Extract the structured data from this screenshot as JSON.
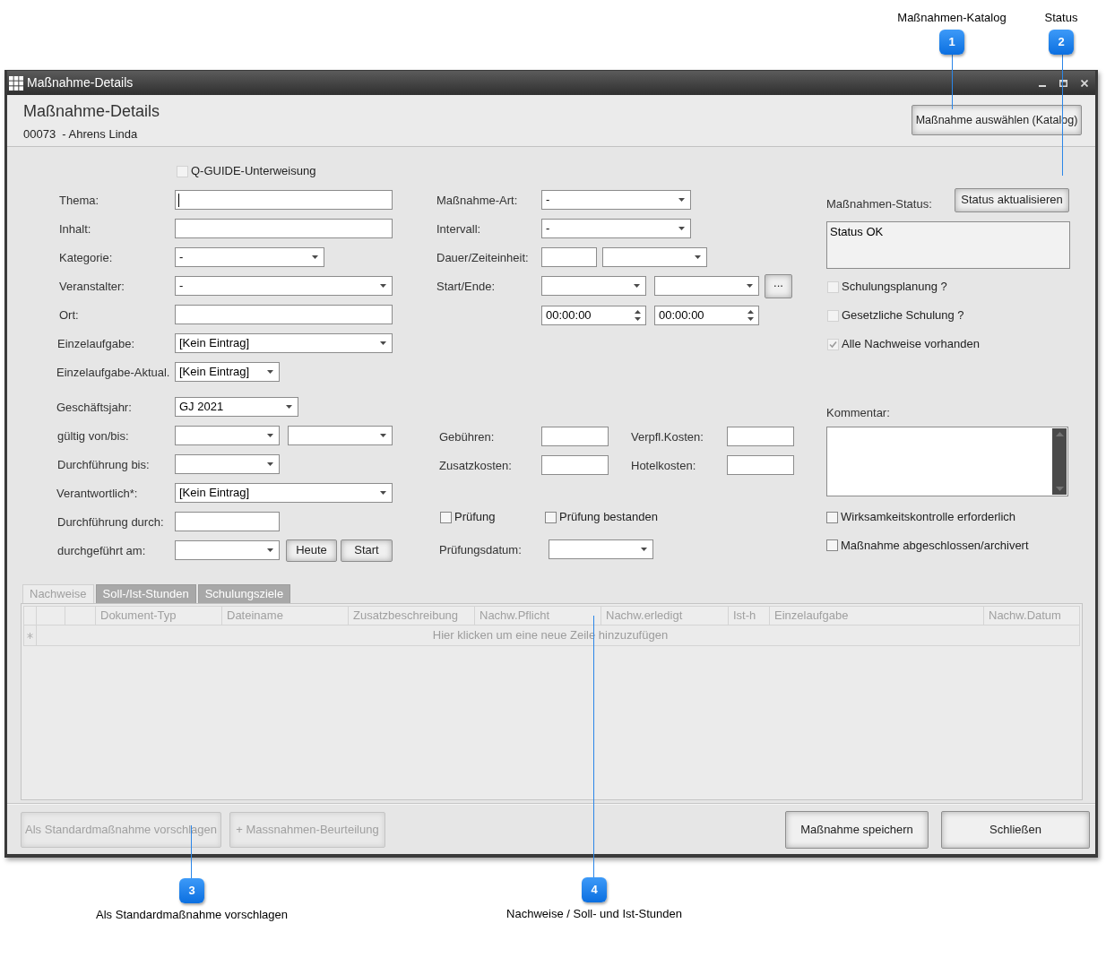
{
  "callouts": [
    {
      "number": "1",
      "label": "Maßnahmen-Katalog"
    },
    {
      "number": "2",
      "label": "Status"
    },
    {
      "number": "3",
      "label": "Als Standardmaßnahme vorschlagen"
    },
    {
      "number": "4",
      "label": "Nachweise / Soll- und Ist-Stunden"
    }
  ],
  "window": {
    "title": "Maßnahme-Details"
  },
  "header": {
    "title": "Maßnahme-Details",
    "record": "00073  - Ahrens Linda",
    "catalog_button": "Maßnahme auswählen (Katalog)"
  },
  "left_form": {
    "q_guide": {
      "label": "Q-GUIDE-Unterweisung",
      "checked": false,
      "disabled": true
    },
    "rows": [
      {
        "label": "Thema:",
        "controls": [
          {
            "kind": "text",
            "focused": true
          }
        ]
      },
      {
        "label": "Inhalt:",
        "controls": [
          {
            "kind": "text",
            "focused": false
          }
        ]
      },
      {
        "label": "Kategorie:",
        "controls": [
          {
            "kind": "dropdown",
            "value": "-"
          }
        ]
      },
      {
        "label": "Veranstalter:",
        "controls": [
          {
            "kind": "dropdown",
            "value": "-"
          }
        ]
      },
      {
        "label": "Ort:",
        "controls": [
          {
            "kind": "text",
            "focused": false
          }
        ]
      },
      {
        "label": "Einzelaufgabe:",
        "controls": [
          {
            "kind": "dropdown",
            "value": "[Kein Eintrag]"
          }
        ]
      },
      {
        "label": "Einzelaufgabe-Aktual.",
        "controls": [
          {
            "kind": "dropdown",
            "value": "[Kein Eintrag]"
          }
        ]
      },
      {
        "label": "Geschäftsjahr:",
        "controls": [
          {
            "kind": "dropdown",
            "value": "GJ 2021"
          }
        ]
      },
      {
        "label": "gültig von/bis:",
        "controls": [
          {
            "kind": "dropdown"
          },
          {
            "kind": "dropdown"
          }
        ]
      },
      {
        "label": "Durchführung bis:",
        "controls": [
          {
            "kind": "dropdown"
          }
        ]
      },
      {
        "label": "Verantwortlich*:",
        "controls": [
          {
            "kind": "dropdown",
            "value": "[Kein Eintrag]"
          }
        ]
      },
      {
        "label": "Durchführung durch:",
        "controls": [
          {
            "kind": "text",
            "focused": false
          }
        ]
      },
      {
        "label": "durchgeführt am:",
        "controls": [
          {
            "kind": "dropdown"
          },
          {
            "kind": "button",
            "label": "Heute"
          },
          {
            "kind": "button",
            "label": "Start"
          }
        ]
      }
    ]
  },
  "middle_form": {
    "rows": [
      {
        "label": "Maßnahme-Art:",
        "controls": [
          {
            "kind": "dropdown",
            "value": "-"
          }
        ]
      },
      {
        "label": "Intervall:",
        "controls": [
          {
            "kind": "dropdown",
            "value": "-"
          }
        ]
      },
      {
        "label": "Dauer/Zeiteinheit:",
        "controls": [
          {
            "kind": "text",
            "focused": false
          },
          {
            "kind": "dropdown"
          }
        ]
      },
      {
        "label": "Start/Ende:",
        "controls": [
          {
            "kind": "dropdown"
          },
          {
            "kind": "dropdown"
          },
          {
            "kind": "button",
            "label": "..."
          }
        ]
      },
      {
        "controls": [
          {
            "kind": "time",
            "value": "00:00:00"
          },
          {
            "kind": "time",
            "value": "00:00:00"
          }
        ]
      }
    ],
    "costs": [
      {
        "label": "Gebühren:"
      },
      {
        "label": "Verpfl.Kosten:"
      },
      {
        "label": "Zusatzkosten:"
      },
      {
        "label": "Hotelkosten:"
      }
    ],
    "checks": [
      {
        "label": "Prüfung",
        "checked": false,
        "disabled": false
      },
      {
        "label": "Prüfung bestanden",
        "checked": false,
        "disabled": false
      }
    ],
    "exam_date": {
      "label": "Prüfungsdatum:"
    }
  },
  "right_form": {
    "status_label": "Maßnahmen-Status:",
    "status_button": "Status aktualisieren",
    "status_text": "Status OK",
    "flags": [
      {
        "label": "Schulungsplanung ?",
        "checked": false,
        "disabled": true
      },
      {
        "label": "Gesetzliche Schulung ?",
        "checked": false,
        "disabled": true
      },
      {
        "label": "Alle Nachweise vorhanden",
        "checked": true,
        "disabled": true
      }
    ],
    "comment_label": "Kommentar:",
    "options": [
      {
        "label": "Wirksamkeitskontrolle erforderlich",
        "checked": false,
        "disabled": false
      },
      {
        "label": "Maßnahme abgeschlossen/archivert",
        "checked": false,
        "disabled": false
      }
    ]
  },
  "tabs": [
    {
      "label": "Nachweise",
      "selected": true
    },
    {
      "label": "Soll-/Ist-Stunden",
      "selected": false
    },
    {
      "label": "Schulungsziele",
      "selected": false
    }
  ],
  "grid": {
    "columns": [
      "Dokument-Typ",
      "Dateiname",
      "Zusatzbeschreibung",
      "Nachw.Pflicht",
      "Nachw.erledigt",
      "Ist-h",
      "Einzelaufgabe",
      "Nachw.Datum"
    ],
    "new_row_hint": "Hier klicken um eine neue Zeile hinzuzufügen"
  },
  "footer_buttons": [
    {
      "label": "Als Standardmaßnahme vorschlagen",
      "disabled": true
    },
    {
      "label": "+ Massnahmen-Beurteilung",
      "disabled": true
    },
    {
      "label": "Maßnahme speichern",
      "disabled": false
    },
    {
      "label": "Schließen",
      "disabled": false
    }
  ]
}
